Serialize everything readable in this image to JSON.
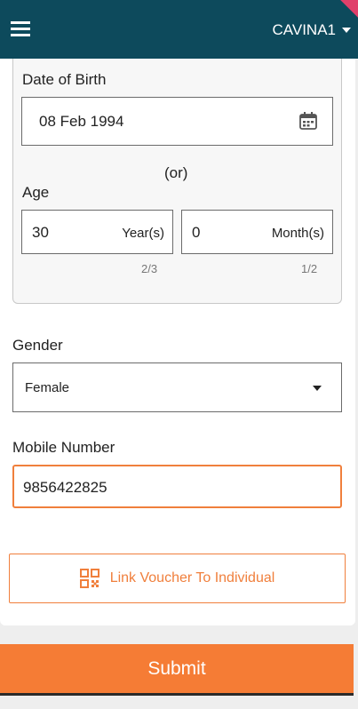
{
  "header": {
    "user_label": "CAVINA1",
    "menu_icon": "hamburger-menu-icon",
    "caret_icon": "caret-down-icon",
    "background_color": "#0d4a5c"
  },
  "dob_section": {
    "dob_label": "Date of Birth",
    "dob_value": "08 Feb 1994",
    "calendar_icon": "calendar-icon",
    "or_text": "(or)",
    "age_label": "Age",
    "years_value": "30",
    "years_unit": "Year(s)",
    "years_hint": "2/3",
    "months_value": "0",
    "months_unit": "Month(s)",
    "months_hint": "1/2"
  },
  "gender": {
    "label": "Gender",
    "selected": "Female"
  },
  "mobile": {
    "label": "Mobile Number",
    "value": "9856422825"
  },
  "link_voucher": {
    "label": "Link Voucher To Individual",
    "icon": "qr-code-icon"
  },
  "submit": {
    "label": "Submit"
  },
  "colors": {
    "accent": "#f57c35",
    "header": "#0d4a5c"
  }
}
